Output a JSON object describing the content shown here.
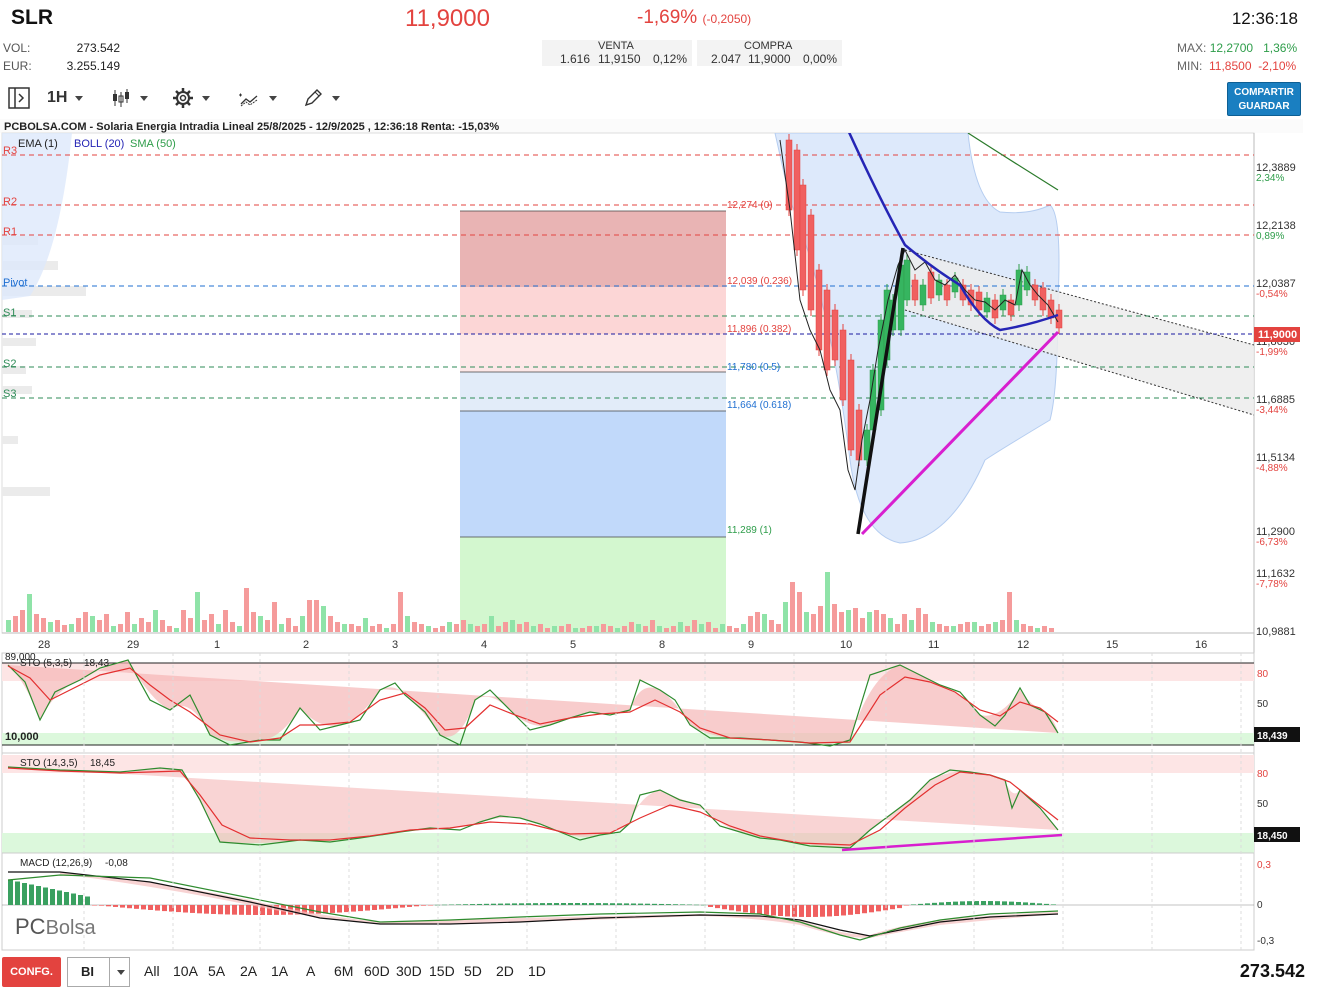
{
  "header": {
    "ticker": "SLR",
    "price": "11,9000",
    "change_pct": "-1,69%",
    "change_abs": "(-0,2050)",
    "time": "12:36:18",
    "vol_label": "VOL:",
    "vol_value": "273.542",
    "eur_label": "EUR:",
    "eur_value": "3.255.149",
    "max_label": "MAX:",
    "max_value": "12,2700",
    "max_pct": "1,36%",
    "min_label": "MIN:",
    "min_value": "11,8500",
    "min_pct": "-2,10%"
  },
  "orderbook": {
    "sell_title": "VENTA",
    "sell_qty": "1.616",
    "sell_price": "11,9150",
    "sell_pct": "0,12%",
    "buy_title": "COMPRA",
    "buy_qty": "2.047",
    "buy_price": "11,9000",
    "buy_pct": "0,00%"
  },
  "toolbar": {
    "timeframe": "1H",
    "share_line1": "COMPARTIR",
    "share_line2": "GUARDAR"
  },
  "chart": {
    "title": "PCBOLSA.COM - Solaria Energia Intradia Lineal 25/8/2025 - 12/9/2025 , 12:36:18 Renta: -15,03%",
    "ema_label": "EMA (1)",
    "boll_label": "BOLL (20)",
    "sma_label": "SMA (50)",
    "pivots": [
      "R3",
      "R2",
      "R1",
      "Pivot",
      "S1",
      "S2",
      "S3"
    ],
    "fib_labels": [
      "12,274 (0)",
      "12,039 (0.236)",
      "11,896 (0.382)",
      "11,780 (0.5)",
      "11,664 (0.618)",
      "11,289 (1)"
    ],
    "price_axis": [
      "12,3889",
      "12,2138",
      "12,0387",
      "11,8636",
      "11,6885",
      "11,5134",
      "11,2900",
      "11,1632",
      "10,9881"
    ],
    "pct_axis": [
      "2,34%",
      "0,89%",
      "-0,54%",
      "-1,99%",
      "-3,44%",
      "-4,88%",
      "-6,73%",
      "-7,78%"
    ],
    "current_price_tag": "11,9000",
    "x_labels": [
      "28",
      "29",
      "1",
      "2",
      "3",
      "4",
      "5",
      "8",
      "9",
      "10",
      "11",
      "12",
      "15",
      "16"
    ],
    "watermark_pc": "PC",
    "watermark_bolsa": "Bolsa"
  },
  "sto1": {
    "label": "STO (5,3,5)",
    "value": "18,43",
    "left_top": "89,000",
    "left_bottom": "10,000",
    "axis_80": "80",
    "axis_50": "50",
    "tag": "18,439"
  },
  "sto2": {
    "label": "STO (14,3,5)",
    "value": "18,45",
    "axis_80": "80",
    "axis_50": "50",
    "tag": "18,450"
  },
  "macd": {
    "label": "MACD (12,26,9)",
    "value": "-0,08",
    "axis_top": "0,3",
    "axis_mid": "0",
    "axis_bot": "-0,3"
  },
  "bottom": {
    "config": "CONFG.",
    "mode": "BI",
    "ranges": [
      "All",
      "10A",
      "5A",
      "2A",
      "1A",
      "A",
      "6M",
      "60D",
      "30D",
      "15D",
      "5D",
      "2D",
      "1D"
    ],
    "volume": "273.542"
  },
  "colors": {
    "up": "#2e9d4a",
    "down": "#e3433f",
    "accent": "#1a7fc1",
    "magenta": "#e020c0"
  }
}
